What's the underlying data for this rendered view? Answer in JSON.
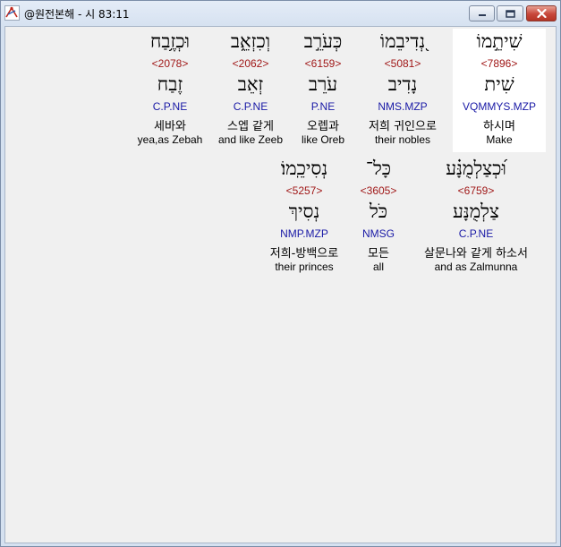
{
  "window": {
    "title": "@원전본해 - 시 83:11"
  },
  "colors": {
    "strong": "#a01818",
    "morph": "#1a1aa6",
    "selected_bg": "#ffffff"
  },
  "words": [
    {
      "hebrew": "שִׁיתֵ֣מוֹ",
      "strong": "<7896>",
      "lexeme": "שִׁית",
      "morph": "VQMMYS.MZP",
      "korean": "하시며",
      "english": "Make",
      "selected": true
    },
    {
      "hebrew": "נְ֭דִיבֵמוֹ",
      "strong": "<5081>",
      "lexeme": "נָדִיב",
      "morph": "NMS.MZP",
      "korean": "저희 귀인으로",
      "english": "their nobles",
      "selected": false
    },
    {
      "hebrew": "כְּעֹרֵ֣ב",
      "strong": "<6159>",
      "lexeme": "עֹרֵב",
      "morph": "P.NE",
      "korean": "오렙과",
      "english": "like Oreb",
      "selected": false
    },
    {
      "hebrew": "וְכִזְאֵ֑ב",
      "strong": "<2062>",
      "lexeme": "זְאֵב",
      "morph": "C.P.NE",
      "korean": "스엡 같게",
      "english": "and like Zeeb",
      "selected": false
    },
    {
      "hebrew": "וּכְזֶ֥בַח",
      "strong": "<2078>",
      "lexeme": "זֶבַח",
      "morph": "C.P.NE",
      "korean": "세바와",
      "english": "yea,as Zebah",
      "selected": false
    },
    {
      "hebrew": "וּ֝כְצַלְמֻנָּ֗ע",
      "strong": "<6759>",
      "lexeme": "צַלְמֻנָּע",
      "morph": "C.P.NE",
      "korean": "살문나와 같게 하소서",
      "english": "and as Zalmunna",
      "selected": false
    },
    {
      "hebrew": "כָּל־",
      "strong": "<3605>",
      "lexeme": "כֹּל",
      "morph": "NMSG",
      "korean": "모든",
      "english": "all",
      "selected": false
    },
    {
      "hebrew": "נְסִיכֵֽמוֹ׃",
      "strong": "<5257>",
      "lexeme": "נְסִיךְ",
      "morph": "NMP.MZP",
      "korean": "저희-방백으로",
      "english": "their princes",
      "selected": false
    }
  ]
}
